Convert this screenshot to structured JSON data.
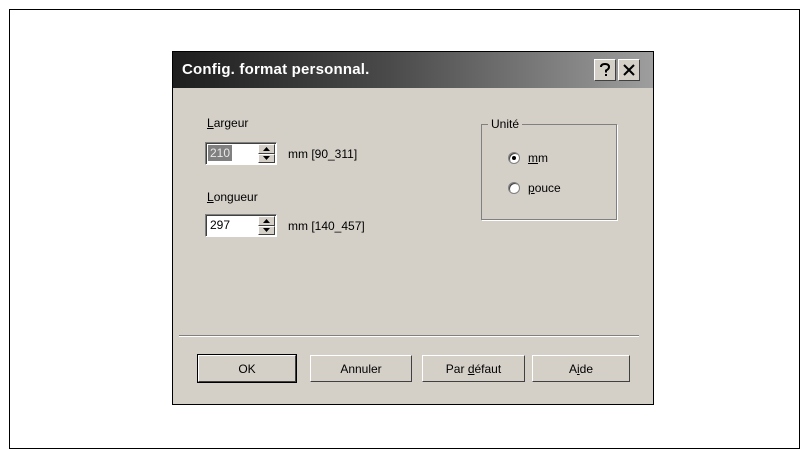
{
  "dialog": {
    "title": "Config. format personnal.",
    "titlebar_buttons": [
      {
        "name": "help",
        "icon": "question-mark-icon"
      },
      {
        "name": "close",
        "icon": "close-x-icon"
      }
    ]
  },
  "width_field": {
    "label_first": "L",
    "label_rest": "argeur",
    "value": "210",
    "range": "mm [90_311]",
    "selected": true
  },
  "length_field": {
    "label_first": "L",
    "label_rest": "ongueur",
    "value": "297",
    "range": "mm [140_457]"
  },
  "unit_group": {
    "legend": "Unité",
    "options": [
      {
        "mnemonic": "m",
        "rest": "m",
        "checked": true
      },
      {
        "mnemonic": "p",
        "rest": "ouce",
        "checked": false
      }
    ]
  },
  "buttons": {
    "ok": "OK",
    "cancel": "Annuler",
    "default_before": "Par ",
    "default_mnemonic": "d",
    "default_after": "éfaut",
    "help_before": "A",
    "help_mnemonic": "i",
    "help_after": "de"
  },
  "colors": {
    "dialog_face": "#d4d0c8",
    "titlebar_dark": "#1e1e1e",
    "titlebar_light": "#9e9e9e"
  }
}
